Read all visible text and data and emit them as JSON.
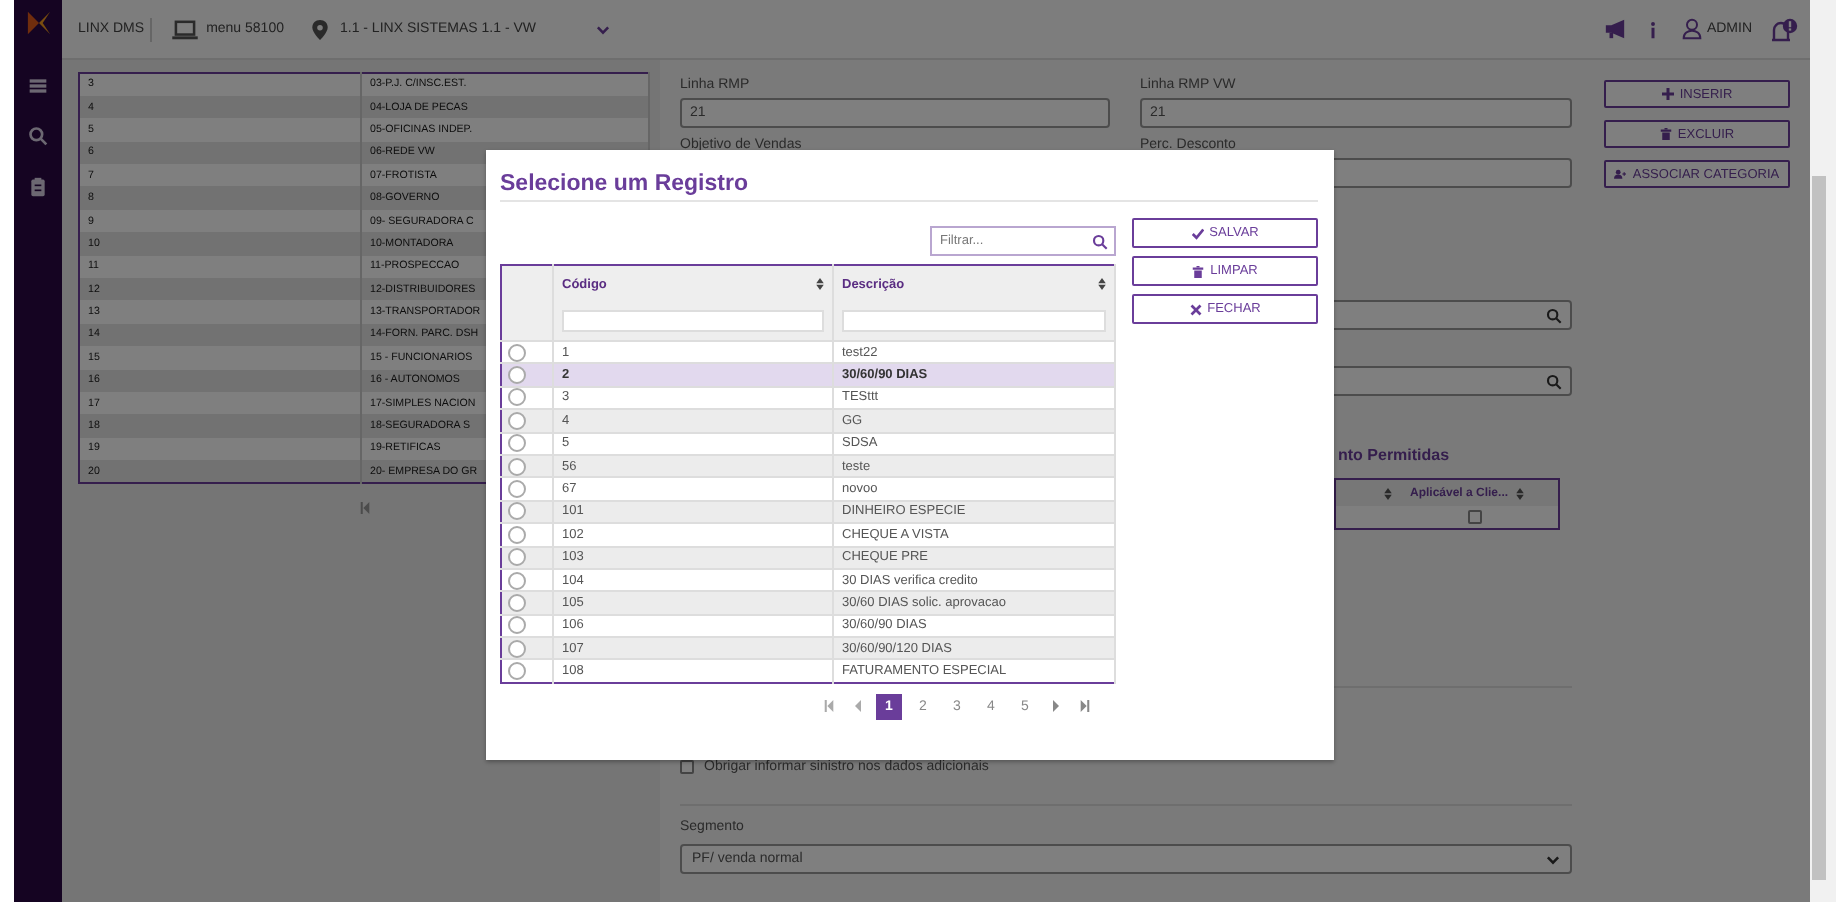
{
  "top_bar": {
    "app_name": "LINX DMS",
    "menu": "menu 58100",
    "branch": "1.1 - LINX SISTEMAS 1.1 - VW",
    "user": "ADMIN"
  },
  "background_table": {
    "rows": [
      {
        "code": "3",
        "description": "03-P.J. C/INSC.EST."
      },
      {
        "code": "4",
        "description": "04-LOJA DE PECAS"
      },
      {
        "code": "5",
        "description": "05-OFICINAS INDEP."
      },
      {
        "code": "6",
        "description": "06-REDE VW"
      },
      {
        "code": "7",
        "description": "07-FROTISTA"
      },
      {
        "code": "8",
        "description": "08-GOVERNO"
      },
      {
        "code": "9",
        "description": "09- SEGURADORA C"
      },
      {
        "code": "10",
        "description": "10-MONTADORA"
      },
      {
        "code": "11",
        "description": "11-PROSPECCAO"
      },
      {
        "code": "12",
        "description": "12-DISTRIBUIDORES"
      },
      {
        "code": "13",
        "description": "13-TRANSPORTADOR"
      },
      {
        "code": "14",
        "description": "14-FORN. PARC. DSH"
      },
      {
        "code": "15",
        "description": "15 - FUNCIONARIOS"
      },
      {
        "code": "16",
        "description": "16 - AUTONOMOS"
      },
      {
        "code": "17",
        "description": "17-SIMPLES NACION"
      },
      {
        "code": "18",
        "description": "18-SEGURADORA S"
      },
      {
        "code": "19",
        "description": "19-RETIFICAS"
      },
      {
        "code": "20",
        "description": "20- EMPRESA DO GR"
      }
    ]
  },
  "form": {
    "fields": [
      {
        "label": "Linha RMP",
        "value": "21"
      },
      {
        "label": "Linha RMP VW",
        "value": "21"
      },
      {
        "label": "Objetivo de Vendas"
      },
      {
        "label": "Perc. Desconto"
      }
    ],
    "section_title": "nto Permitidas",
    "grid_column": "Aplicável a Clie...",
    "grid_checked": false,
    "option": {
      "label": "Obrigar informar sinistro nos dados adicionais",
      "checked": false
    },
    "segment": {
      "label": "Segmento",
      "value": "PF/ venda normal"
    }
  },
  "side_buttons": [
    {
      "label": "INSERIR",
      "kind": "insert"
    },
    {
      "label": "EXCLUIR",
      "kind": "delete"
    },
    {
      "label": "ASSOCIAR CATEGORIA",
      "kind": "associate"
    }
  ],
  "modal": {
    "title": "Selecione um Registro",
    "filter_placeholder": "Filtrar...",
    "columns": [
      "Código",
      "Descrição"
    ],
    "buttons": [
      {
        "label": "SALVAR",
        "kind": "save"
      },
      {
        "label": "LIMPAR",
        "kind": "clear"
      },
      {
        "label": "FECHAR",
        "kind": "close"
      }
    ],
    "rows": [
      {
        "code": "1",
        "description": "test22",
        "selected": false
      },
      {
        "code": "2",
        "description": "30/60/90 DIAS",
        "selected": true
      },
      {
        "code": "3",
        "description": "TESttt",
        "selected": false
      },
      {
        "code": "4",
        "description": "GG",
        "selected": false
      },
      {
        "code": "5",
        "description": "SDSA",
        "selected": false
      },
      {
        "code": "56",
        "description": "teste",
        "selected": false
      },
      {
        "code": "67",
        "description": "novoo",
        "selected": false
      },
      {
        "code": "101",
        "description": "DINHEIRO ESPECIE",
        "selected": false
      },
      {
        "code": "102",
        "description": "CHEQUE A VISTA",
        "selected": false
      },
      {
        "code": "103",
        "description": "CHEQUE PRE",
        "selected": false
      },
      {
        "code": "104",
        "description": "30 DIAS verifica credito",
        "selected": false
      },
      {
        "code": "105",
        "description": "30/60 DIAS solic. aprovacao",
        "selected": false
      },
      {
        "code": "106",
        "description": "30/60/90 DIAS",
        "selected": false
      },
      {
        "code": "107",
        "description": "30/60/90/120 DIAS",
        "selected": false
      },
      {
        "code": "108",
        "description": "FATURAMENTO ESPECIAL",
        "selected": false
      }
    ],
    "pages": [
      {
        "label": "1",
        "selected": true
      },
      {
        "label": "2",
        "selected": false
      },
      {
        "label": "3",
        "selected": false
      },
      {
        "label": "4",
        "selected": false
      },
      {
        "label": "5",
        "selected": false
      }
    ]
  }
}
